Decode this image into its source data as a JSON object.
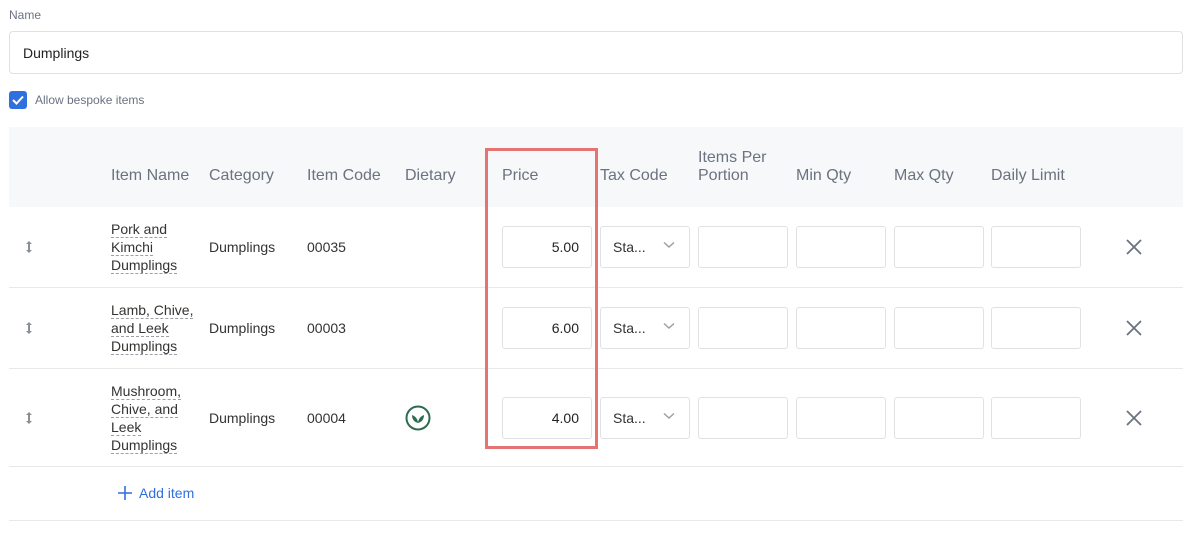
{
  "form": {
    "name_label": "Name",
    "name_value": "Dumplings",
    "allow_bespoke_label": "Allow bespoke items",
    "allow_bespoke_checked": true
  },
  "table": {
    "headers": {
      "item_name": "Item Name",
      "category": "Category",
      "item_code": "Item Code",
      "dietary": "Dietary",
      "price": "Price",
      "tax_code": "Tax Code",
      "items_per_portion_1": "Items Per",
      "items_per_portion_2": "Portion",
      "min_qty": "Min Qty",
      "max_qty": "Max Qty",
      "daily_limit": "Daily Limit"
    },
    "rows": [
      {
        "name_lines": [
          "Pork and",
          "Kimchi",
          "Dumplings"
        ],
        "category": "Dumplings",
        "code": "00035",
        "price": "5.00",
        "tax": "Sta...",
        "dietary_icon": ""
      },
      {
        "name_lines": [
          "Lamb, Chive,",
          "and Leek",
          "Dumplings"
        ],
        "category": "Dumplings",
        "code": "00003",
        "price": "6.00",
        "tax": "Sta...",
        "dietary_icon": ""
      },
      {
        "name_lines": [
          "Mushroom,",
          "Chive, and",
          "Leek",
          "Dumplings"
        ],
        "category": "Dumplings",
        "code": "00004",
        "price": "4.00",
        "tax": "Sta...",
        "dietary_icon": "leaf-icon"
      }
    ],
    "add_item_label": "Add item"
  },
  "colors": {
    "accent": "#2f6fdf",
    "highlight": "#e57373",
    "dietary_green": "#2e6b50"
  }
}
